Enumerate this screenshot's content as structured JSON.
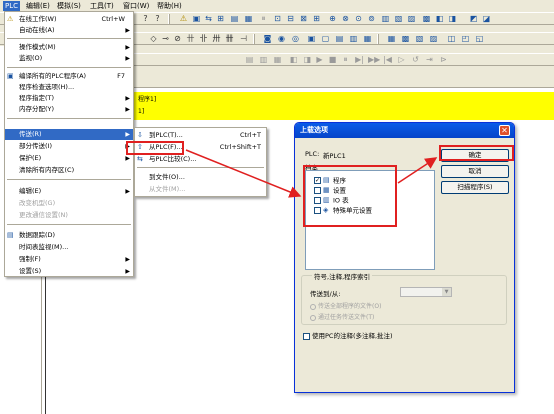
{
  "menubar": {
    "items": [
      "PLC",
      "编辑(E)",
      "模拟(S)",
      "工具(T)",
      "窗口(W)",
      "帮助(H)"
    ],
    "active_index": 0
  },
  "plc_menu": {
    "items": [
      {
        "label": "在线工作(W)",
        "shortcut": "Ctrl+W",
        "icon": "warning-icon",
        "submenu": false,
        "enabled": true
      },
      {
        "label": "自动在线(A)",
        "shortcut": "",
        "submenu": true,
        "enabled": true
      },
      {
        "label": "操作模式(M)",
        "shortcut": "",
        "submenu": true,
        "enabled": true
      },
      {
        "label": "监视(O)",
        "shortcut": "",
        "submenu": true,
        "enabled": true
      },
      {
        "label": "编译所有的PLC程序(A)",
        "shortcut": "F7",
        "icon": "compile-icon",
        "submenu": false,
        "enabled": true
      },
      {
        "label": "程序检查选项(H)...",
        "shortcut": "",
        "submenu": false,
        "enabled": true
      },
      {
        "label": "程序指定(T)",
        "shortcut": "",
        "submenu": true,
        "enabled": true
      },
      {
        "label": "内存分配(Y)",
        "shortcut": "",
        "submenu": true,
        "enabled": true
      },
      {
        "label": "传送(R)",
        "shortcut": "",
        "submenu": true,
        "enabled": true,
        "highlighted": true
      },
      {
        "label": "部分传送(I)",
        "shortcut": "",
        "submenu": true,
        "enabled": true
      },
      {
        "label": "保护(E)",
        "shortcut": "",
        "submenu": true,
        "enabled": true
      },
      {
        "label": "清除所有内存区(C)",
        "shortcut": "",
        "submenu": false,
        "enabled": true
      },
      {
        "label": "编辑(E)",
        "shortcut": "",
        "submenu": true,
        "enabled": true
      },
      {
        "label": "改变机型(G)",
        "shortcut": "",
        "submenu": false,
        "enabled": false
      },
      {
        "label": "更改通信设置(N)",
        "shortcut": "",
        "submenu": false,
        "enabled": false
      },
      {
        "label": "数据跟踪(D)",
        "shortcut": "",
        "icon": "trace-icon",
        "submenu": false,
        "enabled": true
      },
      {
        "label": "时间表监视(M)...",
        "shortcut": "",
        "submenu": false,
        "enabled": true
      },
      {
        "label": "强制(F)",
        "shortcut": "",
        "submenu": true,
        "enabled": true
      },
      {
        "label": "设置(S)",
        "shortcut": "",
        "submenu": true,
        "enabled": true
      }
    ]
  },
  "transfer_submenu": {
    "items": [
      {
        "label": "到PLC(T)...",
        "shortcut": "Ctrl+T",
        "enabled": true
      },
      {
        "label": "从PLC(F)...",
        "shortcut": "Ctrl+Shift+T",
        "enabled": true
      },
      {
        "label": "与PLC比较(C)...",
        "shortcut": "",
        "enabled": true
      },
      {
        "label": "到文件(O)...",
        "shortcut": "",
        "enabled": true
      },
      {
        "label": "从文件(M)...",
        "shortcut": "",
        "enabled": false
      }
    ]
  },
  "ladder": {
    "section_label": "程序1]",
    "rung_marker": "1]"
  },
  "dialog": {
    "title": "上载选项",
    "plc_label": "PLC:",
    "plc_value": "新PLC1",
    "file_label": "档案",
    "files": [
      {
        "label": "程序",
        "checked": true
      },
      {
        "label": "设置",
        "checked": false
      },
      {
        "label": "IO 表",
        "checked": false
      },
      {
        "label": "特殊单元设置",
        "checked": false
      }
    ],
    "ok_button": "确定",
    "cancel_button": "取消",
    "scan_button": "扫描程序(S)",
    "group_title": "符号,注释,程序索引",
    "transfer_label": "传送到/从:",
    "radio_1": "传送全部程序的文件(O)",
    "radio_2": "通过任务传送文件(T)",
    "checkbox_label": "使用PC的注释(多注释,批注)",
    "checkbox_checked": false
  },
  "colors": {
    "highlight": "#316ac5",
    "annotation_red": "#e02020",
    "ladder_yellow": "#ffff00",
    "dialog_title_blue": "#0a5ce8"
  }
}
